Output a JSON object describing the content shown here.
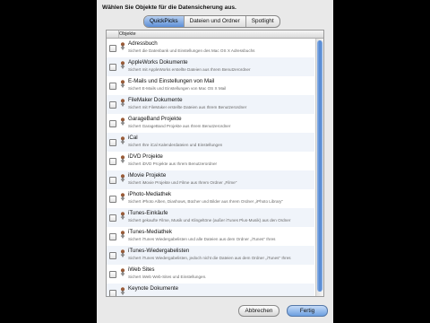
{
  "dialog": {
    "heading": "Wählen Sie Objekte für die Datensicherung aus.",
    "tabs": [
      {
        "label": "QuickPicks",
        "active": true
      },
      {
        "label": "Dateien und Ordner",
        "active": false
      },
      {
        "label": "Spotlight",
        "active": false
      }
    ],
    "column_header": "Objekte",
    "items": [
      {
        "title": "Adressbuch",
        "desc": "Sichert die Datenbank und Einstellungen des Mac OS X Adressbuchs",
        "icon": "app-icon"
      },
      {
        "title": "AppleWorks Dokumente",
        "desc": "Sichert mit AppleWorks erstellte Dateien aus Ihrem Benutzerordner",
        "icon": "app-icon"
      },
      {
        "title": "E-Mails und Einstellungen von Mail",
        "desc": "Sichert E-Mails und Einstellungen von Mac OS X Mail",
        "icon": "app-icon"
      },
      {
        "title": "FileMaker Dokumente",
        "desc": "Sichert mit FileMaker erstellte Dateien aus Ihrem Benutzerordner",
        "icon": "app-icon"
      },
      {
        "title": "GarageBand Projekte",
        "desc": "Sichert GarageBand Projekte aus Ihrem Benutzerordner",
        "icon": "app-icon"
      },
      {
        "title": "iCal",
        "desc": "Sichert Ihre iCal Kalenderdateien und Einstellungen",
        "icon": "app-icon"
      },
      {
        "title": "iDVD Projekte",
        "desc": "Sichert iDVD Projekte aus Ihrem Benutzerordner",
        "icon": "app-icon"
      },
      {
        "title": "iMovie Projekte",
        "desc": "Sichert iMovie Projekte und Filme aus Ihrem Ordner „Filme\"",
        "icon": "app-icon"
      },
      {
        "title": "iPhoto-Mediathek",
        "desc": "Sichert iPhoto Alben, Diashows, Bücher und Bilder aus Ihrem Ordner „iPhoto Library\"",
        "icon": "app-icon"
      },
      {
        "title": "iTunes-Einkäufe",
        "desc": "Sichert gekaufte Filme, Musik und Klingeltöne (außer iTunes Plus-Musik) aus den Ordner",
        "icon": "app-icon"
      },
      {
        "title": "iTunes-Mediathek",
        "desc": "Sichert iTunes Wiedergabelisten und alle Dateien aus dem Ordner „iTunes\" Ihres",
        "icon": "app-icon"
      },
      {
        "title": "iTunes-Wiedergabelisten",
        "desc": "Sichert iTunes Wiedergabelisten, jedoch nicht die Dateien aus dem Ordner „iTunes\" Ihres",
        "icon": "app-icon"
      },
      {
        "title": "iWeb Sites",
        "desc": "Sichert iWeb Web-Sites und Einstellungen.",
        "icon": "app-icon"
      },
      {
        "title": "Keynote Dokumente",
        "desc": "",
        "icon": "app-icon"
      }
    ],
    "buttons": {
      "cancel": "Abbrechen",
      "done": "Fertig"
    },
    "accent_color": "#5d8fd6"
  }
}
